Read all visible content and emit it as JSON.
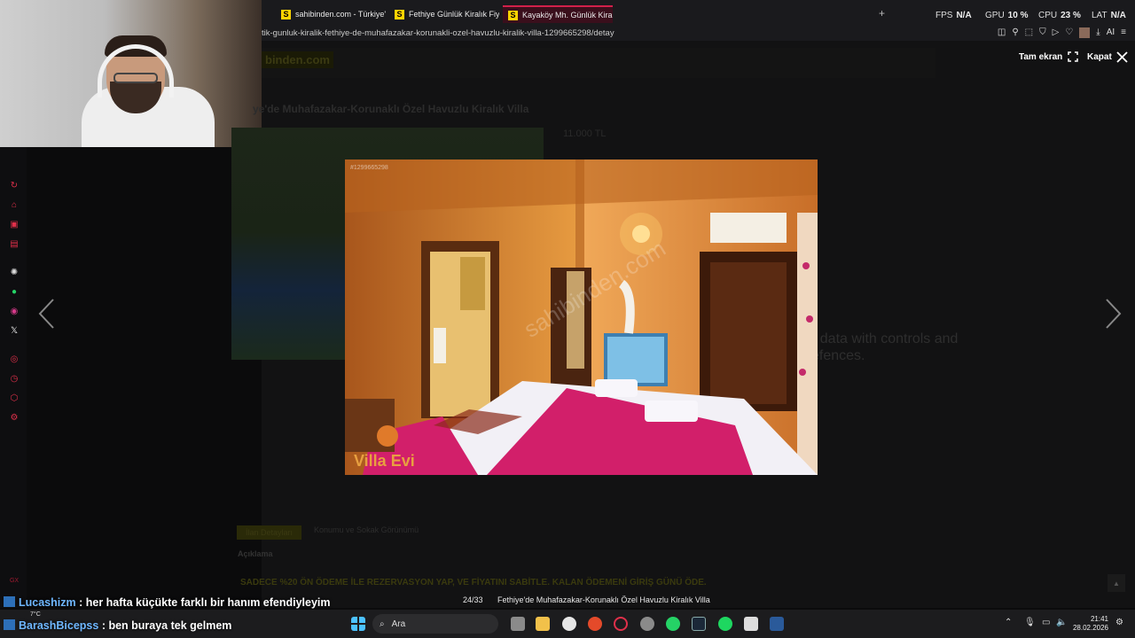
{
  "browser": {
    "tabs": [
      {
        "label": "sahibinden.com - Türkiye'",
        "favicon": "S"
      },
      {
        "label": "Fethiye Günlük Kiralık Fiyat",
        "favicon": "S"
      },
      {
        "label": "Kayaköy Mh. Günlük Kiralık",
        "favicon": "S"
      }
    ],
    "new_tab": "+",
    "url": "tik-gunluk-kiralik-fethiye-de-muhafazakar-korunakli-ozel-havuzlu-kiralik-villa-1299665298/detay"
  },
  "perf": {
    "fps_label": "FPS",
    "fps_value": "N/A",
    "gpu_label": "GPU",
    "gpu_value": "10 %",
    "cpu_label": "CPU",
    "cpu_value": "23 %",
    "lat_label": "LAT",
    "lat_value": "N/A"
  },
  "page": {
    "logo": "binden.com",
    "title": "ye'de Muhafazakar-Korunaklı Özel Havuzlu Kiralık Villa",
    "price": "11.000 TL",
    "ad_text": "r data with controls and efences.",
    "tab_on": "İlan Detayları",
    "tab_off": "Konumu ve Sokak Görünümü",
    "desc_label": "Açıklama",
    "promo": "SADECE %20 ÖN ÖDEME İLE REZERVASYON YAP, VE FİYATINI SABİTLE. KALAN ÖDEMENİ GİRİŞ GÜNÜ ÖDE."
  },
  "lightbox": {
    "fullscreen_label": "Tam ekran",
    "close_label": "Kapat",
    "photo_id": "#1299665298",
    "watermark": "sahibinden.com",
    "brand": "Villa Evi",
    "counter": "24/33",
    "caption": "Fethiye'de Muhafazakar-Korunaklı Özel Havuzlu Kiralık Villa",
    "prev_icon": "chevron-left-icon",
    "next_icon": "chevron-right-icon"
  },
  "chat": [
    {
      "user": "Lucashizm",
      "message": ": her hafta küçükte farklı bir hanım efendiyleyim"
    },
    {
      "user": "BarashBicepss",
      "message": ": ben buraya tek gelmem"
    }
  ],
  "taskbar": {
    "search_label": "Ara",
    "weather": "7°C",
    "time": "21:41",
    "date": "28.02.2026"
  },
  "colors": {
    "accent": "#d0204a",
    "brand_yellow": "#ffd400",
    "chat_user": "#6fb7ff"
  }
}
